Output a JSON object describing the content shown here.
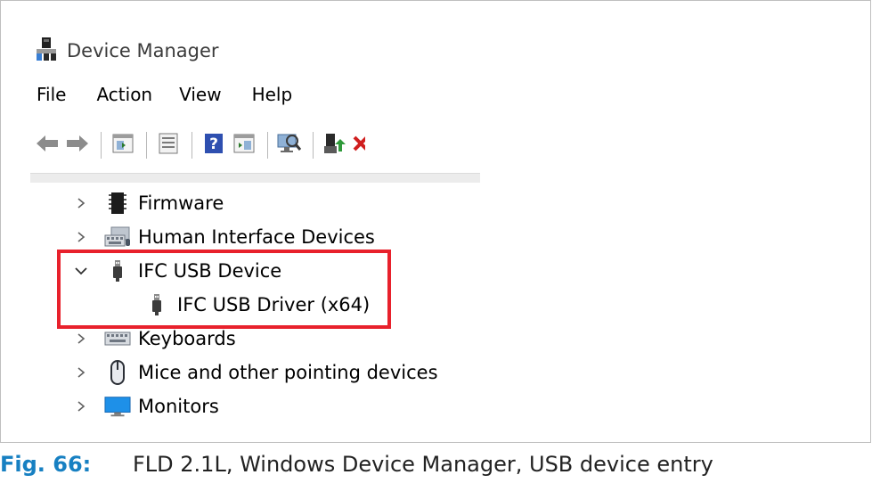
{
  "window": {
    "title": "Device Manager"
  },
  "menu": [
    "File",
    "Action",
    "View",
    "Help"
  ],
  "toolbar": {
    "buttons": [
      {
        "icon": "back-arrow-icon"
      },
      {
        "icon": "forward-arrow-icon"
      },
      {
        "icon": "show-hide-console-tree-icon"
      },
      {
        "icon": "properties-icon"
      },
      {
        "icon": "help-icon",
        "glyph": "?"
      },
      {
        "icon": "action-pane-icon"
      },
      {
        "icon": "scan-hardware-icon"
      },
      {
        "icon": "update-driver-icon"
      },
      {
        "icon": "uninstall-device-icon"
      }
    ]
  },
  "tree": [
    {
      "label": "Firmware",
      "expanded": false,
      "icon": "firmware-chip-icon"
    },
    {
      "label": "Human Interface Devices",
      "expanded": false,
      "icon": "hid-keyboard-icon"
    },
    {
      "label": "IFC USB Device",
      "expanded": true,
      "icon": "usb-plug-icon",
      "children": [
        {
          "label": "IFC USB Driver (x64)",
          "icon": "usb-plug-icon"
        }
      ]
    },
    {
      "label": "Keyboards",
      "expanded": false,
      "icon": "keyboard-icon"
    },
    {
      "label": "Mice and other pointing devices",
      "expanded": false,
      "icon": "mouse-icon"
    },
    {
      "label": "Monitors",
      "expanded": false,
      "icon": "monitor-icon"
    }
  ],
  "highlight_color": "#e8212c",
  "caption": {
    "number": "Fig. 66:",
    "text": "FLD 2.1L, Windows Device Manager, USB device entry",
    "number_color": "#1780c2"
  }
}
